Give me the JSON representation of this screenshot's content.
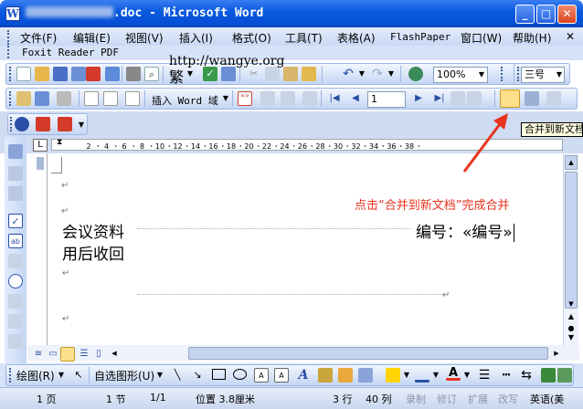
{
  "window": {
    "title_suffix": ".doc - Microsoft Word",
    "minimize": "_",
    "maximize": "□",
    "close": "✕"
  },
  "menu": {
    "items": [
      "文件(F)",
      "编辑(E)",
      "视图(V)",
      "插入(I)",
      "格式(O)",
      "工具(T)",
      "表格(A)",
      "FlashPaper",
      "窗口(W)",
      "帮助(H)"
    ],
    "close_doc": "✕"
  },
  "foxit": {
    "label": "Foxit Reader PDF"
  },
  "standard_toolbar": {
    "traditional_char": "繁",
    "zoom_value": "100%",
    "font_size": "三号"
  },
  "watermark_url": "http://wangye.org",
  "mailmerge_toolbar": {
    "insert_word_field": "插入 Word 域",
    "record_number": "1"
  },
  "tooltip": {
    "text": "合并到新文档"
  },
  "ruler": {
    "ticks": [
      "2",
      "4",
      "6",
      "8",
      "10",
      "12",
      "14",
      "16",
      "18",
      "20",
      "22",
      "24",
      "26",
      "28",
      "30",
      "32",
      "34",
      "36",
      "38"
    ]
  },
  "document": {
    "hint": "点击“合并到新文档”完成合并",
    "left_line1": "会议资料",
    "left_line2": "用后收回",
    "right_label": "编号：«编号»",
    "paragraph_mark": "↵"
  },
  "drawing_toolbar": {
    "draw_label": "绘图(R)",
    "autoshape_label": "自选图形(U)"
  },
  "status": {
    "page": "1 页",
    "section": "1 节",
    "pages": "1/1",
    "position": "位置 3.8厘米",
    "line": "3 行",
    "column": "40 列",
    "rec": "录制",
    "trk": "修订",
    "ext": "扩展",
    "ovr": "改写",
    "lang": "英语(美"
  },
  "colors": {
    "title_blue": "#0a5ae0",
    "hint_red": "#e8341f",
    "toolbar_blue": "#c4d6f4"
  }
}
